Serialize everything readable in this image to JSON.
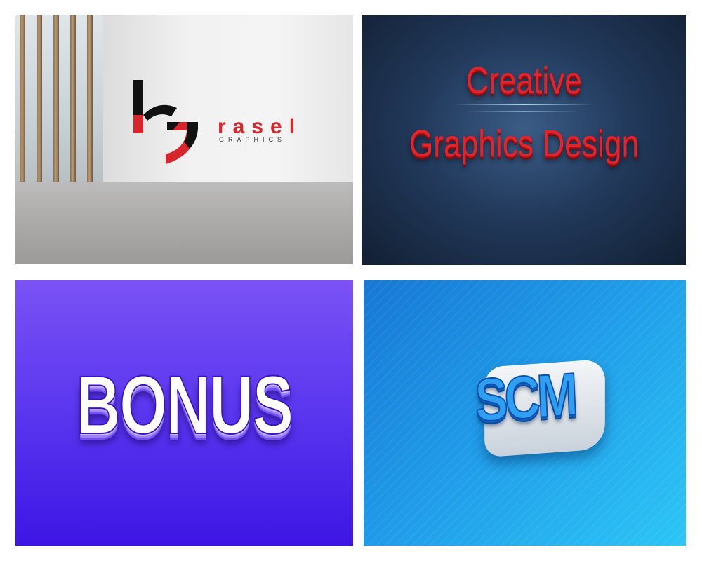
{
  "panels": {
    "logo_mockup": {
      "wordmark": "rasel",
      "tagline": "GRAPHICS",
      "colors": {
        "brand_red": "#d6262b",
        "brand_black": "#111111"
      }
    },
    "creative_design": {
      "line1": "Creative",
      "line2": "Graphics Design",
      "colors": {
        "text": "#e3242b",
        "background": "#223a5c"
      }
    },
    "bonus": {
      "text": "BONUS",
      "colors": {
        "background": "#5a36ef",
        "text": "#ffffff"
      }
    },
    "scm": {
      "text": "SCM",
      "colors": {
        "background": "#1f9ae8",
        "text": "#2f9ff1"
      }
    }
  }
}
